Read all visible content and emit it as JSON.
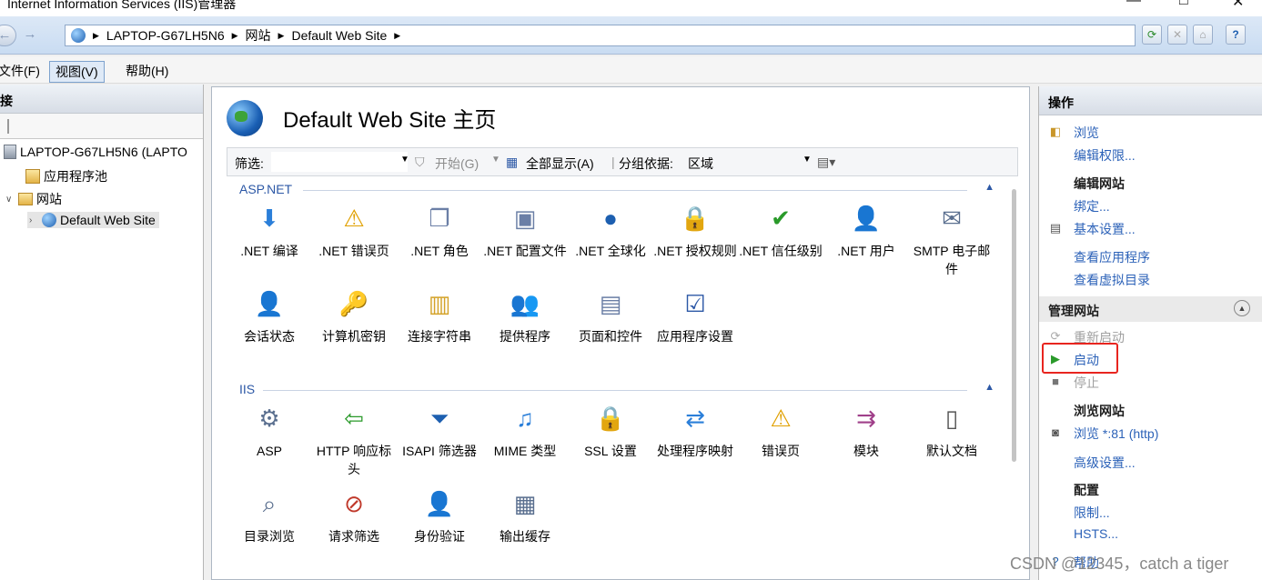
{
  "window": {
    "title": "Internet Information Services (IIS)管理器"
  },
  "address": {
    "crumbs": [
      "LAPTOP-G67LH5N6",
      "网站",
      "Default Web Site"
    ]
  },
  "menu": {
    "file": "文件(F)",
    "view": "视图(V)",
    "help": "帮助(H)"
  },
  "left": {
    "header": "接",
    "tree": {
      "server": "LAPTOP-G67LH5N6 (LAPTO",
      "app_pools": "应用程序池",
      "sites": "网站",
      "site": "Default Web Site"
    }
  },
  "center": {
    "title": "Default Web Site 主页",
    "filter": {
      "label": "筛选:",
      "start": "开始(G)",
      "show_all": "全部显示(A)",
      "group_by": "分组依据:",
      "group_value": "区域"
    },
    "sections": {
      "aspnet": "ASP.NET",
      "iis": "IIS"
    },
    "aspnet_items": [
      ".NET 编译",
      ".NET 错误页",
      ".NET 角色",
      ".NET 配置文件",
      ".NET 全球化",
      ".NET 授权规则",
      ".NET 信任级别",
      ".NET 用户",
      "SMTP 电子邮件",
      "会话状态",
      "计算机密钥",
      "连接字符串",
      "提供程序",
      "页面和控件",
      "应用程序设置"
    ],
    "iis_items": [
      "ASP",
      "HTTP 响应标头",
      "ISAPI 筛选器",
      "MIME 类型",
      "SSL 设置",
      "处理程序映射",
      "错误页",
      "模块",
      "默认文档",
      "目录浏览",
      "请求筛选",
      "身份验证",
      "输出缓存"
    ]
  },
  "right": {
    "header": "操作",
    "browse": "浏览",
    "edit_perms": "编辑权限...",
    "edit_site": "编辑网站",
    "bindings": "绑定...",
    "basic_settings": "基本设置...",
    "view_apps": "查看应用程序",
    "view_vdirs": "查看虚拟目录",
    "manage_site": "管理网站",
    "restart": "重新启动",
    "start": "启动",
    "stop": "停止",
    "browse_site": "浏览网站",
    "browse_81": "浏览 *:81 (http)",
    "advanced": "高级设置...",
    "config": "配置",
    "limits": "限制...",
    "hsts": "HSTS...",
    "help": "帮助"
  },
  "watermark": "CSDN @12345，catch a tiger"
}
